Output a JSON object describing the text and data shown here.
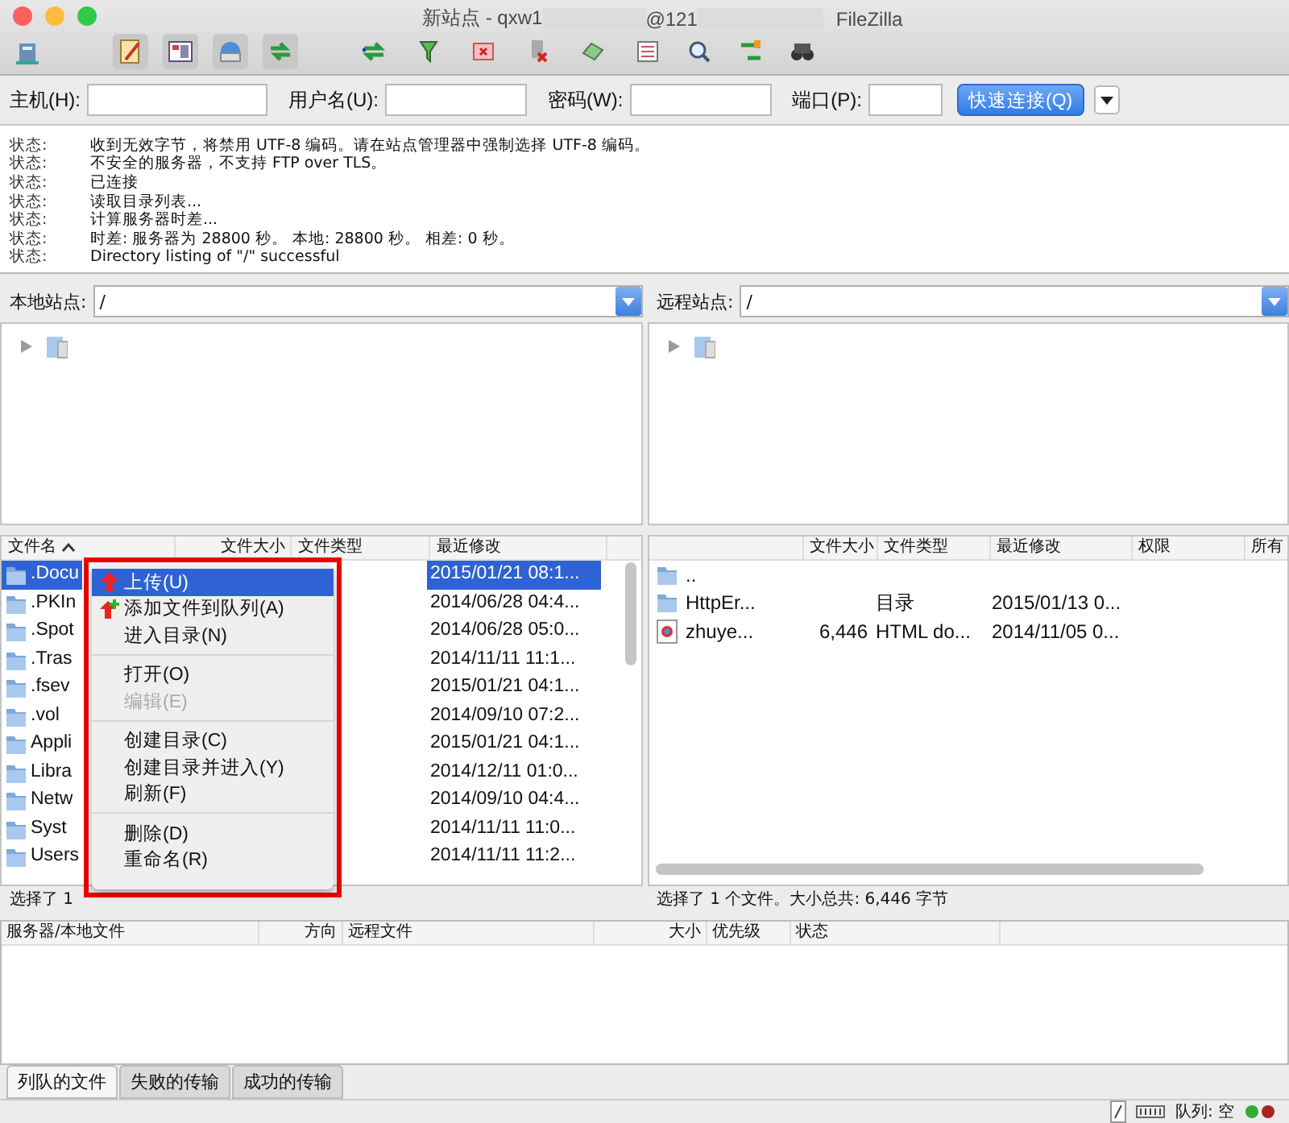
{
  "window": {
    "title_parts": [
      "新站点 - qxw1",
      "@121",
      "FileZilla"
    ]
  },
  "quickconnect": {
    "fields": [
      {
        "label": "主机(H):"
      },
      {
        "label": "用户名(U):"
      },
      {
        "label": "密码(W):"
      },
      {
        "label": "端口(P):"
      }
    ],
    "button": "快速连接(Q)"
  },
  "log": [
    {
      "label": "状态:",
      "text": "收到无效字节，将禁用 UTF-8 编码。请在站点管理器中强制选择 UTF-8 编码。"
    },
    {
      "label": "状态:",
      "text": "不安全的服务器，不支持 FTP over TLS。"
    },
    {
      "label": "状态:",
      "text": "已连接"
    },
    {
      "label": "状态:",
      "text": "读取目录列表..."
    },
    {
      "label": "状态:",
      "text": "计算服务器时差..."
    },
    {
      "label": "状态:",
      "text": "时差: 服务器为 28800 秒。 本地: 28800 秒。 相差: 0 秒。"
    },
    {
      "label": "状态:",
      "text": "Directory listing of \"/\" successful"
    }
  ],
  "local": {
    "site_label": "本地站点:",
    "path": "/",
    "columns": [
      "文件名",
      "文件大小",
      "文件类型",
      "最近修改"
    ],
    "rows": [
      {
        "name": ".Docu",
        "date": "2015/01/21 08:1...",
        "selected": true
      },
      {
        "name": ".PKIn",
        "date": "2014/06/28 04:4...",
        "selected": false
      },
      {
        "name": ".Spot",
        "date": "2014/06/28 05:0...",
        "selected": false
      },
      {
        "name": ".Tras",
        "date": "2014/11/11 11:1...",
        "selected": false
      },
      {
        "name": ".fsev",
        "date": "2015/01/21 04:1...",
        "selected": false
      },
      {
        "name": ".vol",
        "date": "2014/09/10 07:2...",
        "selected": false
      },
      {
        "name": "Appli",
        "date": "2015/01/21 04:1...",
        "selected": false
      },
      {
        "name": "Libra",
        "date": "2014/12/11 01:0...",
        "selected": false
      },
      {
        "name": "Netw",
        "date": "2014/09/10 04:4...",
        "selected": false
      },
      {
        "name": "Syst",
        "date": "2014/11/11 11:0...",
        "selected": false
      },
      {
        "name": "Users",
        "date": "2014/11/11 11:2...",
        "selected": false
      }
    ],
    "status": "选择了 1"
  },
  "remote": {
    "site_label": "远程站点:",
    "path": "/",
    "columns": [
      "文件大小",
      "文件类型",
      "最近修改",
      "权限",
      "所有"
    ],
    "rows": [
      {
        "kind": "folder",
        "name": "..",
        "size": "",
        "type": "",
        "date": ""
      },
      {
        "kind": "folder",
        "name": "HttpEr...",
        "size": "",
        "type": "目录",
        "date": "2015/01/13 0..."
      },
      {
        "kind": "html",
        "name": "zhuye...",
        "size": "6,446",
        "type": "HTML do...",
        "date": "2014/11/05 0..."
      }
    ],
    "status": "选择了 1 个文件。大小总共: 6,446 字节"
  },
  "context_menu": [
    {
      "kind": "upload",
      "label": "上传(U)",
      "selected": true,
      "disabled": false
    },
    {
      "kind": "enqueue",
      "label": "添加文件到队列(A)",
      "selected": false,
      "disabled": false
    },
    {
      "kind": "item",
      "label": "进入目录(N)",
      "selected": false,
      "disabled": false
    },
    {
      "kind": "separator"
    },
    {
      "kind": "item",
      "label": "打开(O)",
      "selected": false,
      "disabled": false
    },
    {
      "kind": "item",
      "label": "编辑(E)",
      "selected": false,
      "disabled": true
    },
    {
      "kind": "separator"
    },
    {
      "kind": "item",
      "label": "创建目录(C)",
      "selected": false,
      "disabled": false
    },
    {
      "kind": "item",
      "label": "创建目录并进入(Y)",
      "selected": false,
      "disabled": false
    },
    {
      "kind": "item",
      "label": "刷新(F)",
      "selected": false,
      "disabled": false
    },
    {
      "kind": "separator"
    },
    {
      "kind": "item",
      "label": "删除(D)",
      "selected": false,
      "disabled": false
    },
    {
      "kind": "item",
      "label": "重命名(R)",
      "selected": false,
      "disabled": false
    }
  ],
  "queue": {
    "columns": [
      "服务器/本地文件",
      "方向",
      "远程文件",
      "大小",
      "优先级",
      "状态"
    ],
    "tabs": [
      {
        "label": "列队的文件",
        "selected": true
      },
      {
        "label": "失败的传输",
        "selected": false
      },
      {
        "label": "成功的传输",
        "selected": false
      }
    ]
  },
  "status_bar": {
    "queue": "队列: 空"
  }
}
